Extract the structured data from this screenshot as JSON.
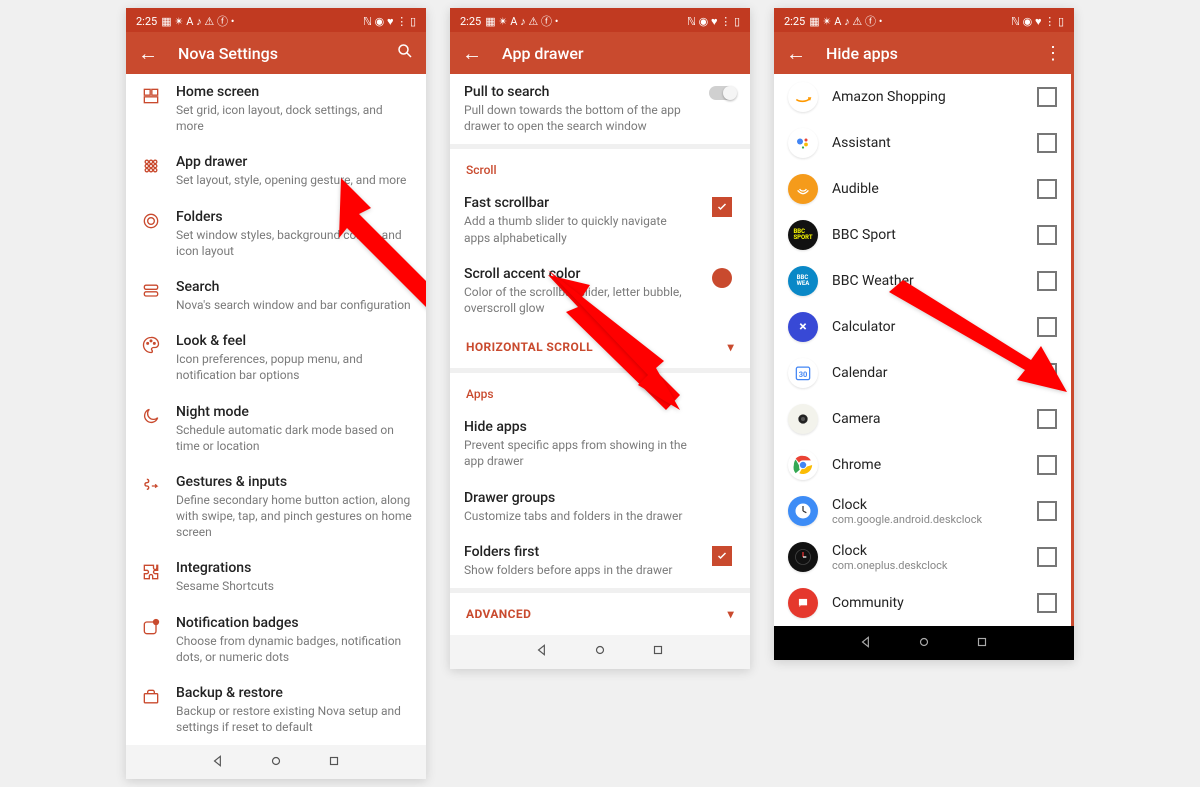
{
  "status": {
    "time": "2:25",
    "left_icons": "▦ ✴ A ♪ ⚠ ⓕ •",
    "right_icons": "ℕ ◉ ♥ ⋮ ▯"
  },
  "screen1": {
    "title": "Nova Settings",
    "items": [
      {
        "icon": "home",
        "title": "Home screen",
        "sub": "Set grid, icon layout, dock settings, and more"
      },
      {
        "icon": "drawer",
        "title": "App drawer",
        "sub": "Set layout, style, opening gesture, and more"
      },
      {
        "icon": "folder",
        "title": "Folders",
        "sub": "Set window styles, background colors, and icon layout"
      },
      {
        "icon": "search",
        "title": "Search",
        "sub": "Nova's search window and bar configuration"
      },
      {
        "icon": "palette",
        "title": "Look & feel",
        "sub": "Icon preferences, popup menu, and notification bar options"
      },
      {
        "icon": "moon",
        "title": "Night mode",
        "sub": "Schedule automatic dark mode based on time or location"
      },
      {
        "icon": "gesture",
        "title": "Gestures & inputs",
        "sub": "Define secondary home button action, along with swipe, tap, and pinch gestures on home screen"
      },
      {
        "icon": "puzzle",
        "title": "Integrations",
        "sub": "Sesame Shortcuts"
      },
      {
        "icon": "badge",
        "title": "Notification badges",
        "sub": "Choose from dynamic badges, notification dots, or numeric dots"
      },
      {
        "icon": "backup",
        "title": "Backup & restore",
        "sub": "Backup or restore existing Nova setup and settings if reset to default"
      }
    ]
  },
  "screen2": {
    "title": "App drawer",
    "group0": [
      {
        "title": "Pull to search",
        "sub": "Pull down towards the bottom of the app drawer to open the search window",
        "tail": "switch"
      }
    ],
    "section1_label": "Scroll",
    "group1": [
      {
        "title": "Fast scrollbar",
        "sub": "Add a thumb slider to quickly navigate apps alphabetically",
        "tail": "check"
      },
      {
        "title": "Scroll accent color",
        "sub": "Color of the scrollbar slider, letter bubble, overscroll glow",
        "tail": "color"
      }
    ],
    "expand1": "HORIZONTAL SCROLL",
    "section2_label": "Apps",
    "group2": [
      {
        "title": "Hide apps",
        "sub": "Prevent specific apps from showing in the app drawer"
      },
      {
        "title": "Drawer groups",
        "sub": "Customize tabs and folders in the drawer"
      },
      {
        "title": "Folders first",
        "sub": "Show folders before apps in the drawer",
        "tail": "check"
      }
    ],
    "expand2": "ADVANCED"
  },
  "screen3": {
    "title": "Hide apps",
    "apps": [
      {
        "name": "Amazon Shopping",
        "bg": "#fff",
        "bgimg": "amazon"
      },
      {
        "name": "Assistant",
        "bg": "#fff",
        "bgimg": "assistant"
      },
      {
        "name": "Audible",
        "bg": "#f59b1b"
      },
      {
        "name": "BBC Sport",
        "bg": "#111"
      },
      {
        "name": "BBC Weather",
        "bg": "#0a88c7"
      },
      {
        "name": "Calculator",
        "bg": "#3849d6"
      },
      {
        "name": "Calendar",
        "bg": "#fff",
        "bgimg": "calendar"
      },
      {
        "name": "Camera",
        "bg": "#f3f3ec",
        "bgimg": "camera"
      },
      {
        "name": "Chrome",
        "bg": "#fff",
        "bgimg": "chrome"
      },
      {
        "name": "Clock",
        "sub": "com.google.android.deskclock",
        "bg": "#3d8cf6",
        "bgimg": "clock1"
      },
      {
        "name": "Clock",
        "sub": "com.oneplus.deskclock",
        "bg": "#111",
        "bgimg": "clock2"
      },
      {
        "name": "Community",
        "bg": "#e5382d"
      }
    ]
  }
}
